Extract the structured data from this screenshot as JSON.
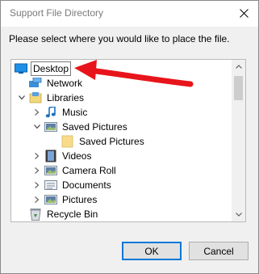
{
  "window": {
    "title": "Support File Directory",
    "prompt": "Please select where you would like to place the file."
  },
  "tree": {
    "items": [
      {
        "label": "Desktop",
        "icon": "desktop-icon",
        "expander": "none",
        "selected": true
      },
      {
        "label": "Network",
        "icon": "network-icon",
        "expander": "none"
      },
      {
        "label": "Libraries",
        "icon": "libraries-icon",
        "expander": "expanded"
      },
      {
        "label": "Music",
        "icon": "music-icon",
        "expander": "collapsed"
      },
      {
        "label": "Saved Pictures",
        "icon": "pictures-library-icon",
        "expander": "expanded"
      },
      {
        "label": "Saved Pictures",
        "icon": "folder-icon",
        "expander": "none"
      },
      {
        "label": "Videos",
        "icon": "videos-icon",
        "expander": "collapsed"
      },
      {
        "label": "Camera Roll",
        "icon": "pictures-library-icon",
        "expander": "collapsed"
      },
      {
        "label": "Documents",
        "icon": "documents-icon",
        "expander": "collapsed"
      },
      {
        "label": "Pictures",
        "icon": "pictures-library-icon",
        "expander": "collapsed"
      },
      {
        "label": "Recycle Bin",
        "icon": "recycle-bin-icon",
        "expander": "none"
      }
    ]
  },
  "buttons": {
    "ok": "OK",
    "cancel": "Cancel"
  },
  "colors": {
    "annotation_arrow": "#e8141b",
    "ok_focus_border": "#0078d7"
  }
}
